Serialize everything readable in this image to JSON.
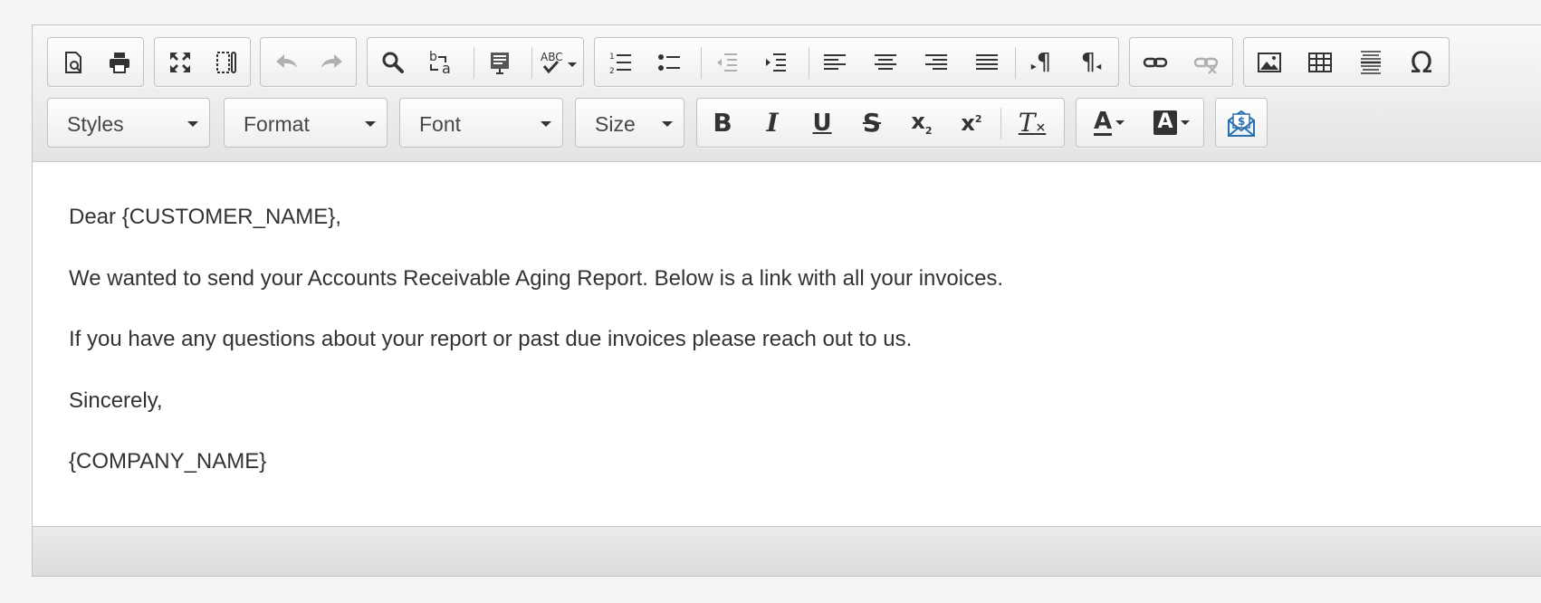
{
  "toolbar": {
    "row1": {
      "document": [
        {
          "name": "preview-icon",
          "title": "Preview"
        },
        {
          "name": "print-icon",
          "title": "Print"
        }
      ],
      "view": [
        {
          "name": "maximize-icon",
          "title": "Maximize"
        },
        {
          "name": "show-blocks-icon",
          "title": "Show Blocks"
        }
      ],
      "history": [
        {
          "name": "undo-icon",
          "title": "Undo",
          "disabled": true
        },
        {
          "name": "redo-icon",
          "title": "Redo",
          "disabled": true
        }
      ],
      "editing": [
        {
          "name": "find-icon",
          "title": "Find"
        },
        {
          "name": "replace-icon",
          "title": "Replace"
        },
        {
          "name": "templates-icon",
          "title": "Templates"
        },
        {
          "name": "spellcheck-icon",
          "title": "Spell Check",
          "label": "ABC"
        }
      ],
      "paragraph": [
        {
          "name": "numbered-list-icon"
        },
        {
          "name": "bulleted-list-icon"
        },
        {
          "name": "outdent-icon",
          "disabled": true
        },
        {
          "name": "indent-icon"
        },
        {
          "name": "align-left-icon"
        },
        {
          "name": "align-center-icon"
        },
        {
          "name": "align-right-icon"
        },
        {
          "name": "justify-icon"
        },
        {
          "name": "ltr-icon",
          "glyph": "¶"
        },
        {
          "name": "rtl-icon",
          "glyph": "¶"
        }
      ],
      "links": [
        {
          "name": "link-icon"
        },
        {
          "name": "unlink-icon",
          "disabled": true
        }
      ],
      "insert": [
        {
          "name": "image-icon"
        },
        {
          "name": "table-icon"
        },
        {
          "name": "horizontal-rule-icon"
        },
        {
          "name": "special-char-icon",
          "glyph": "Ω"
        }
      ]
    },
    "combos": {
      "styles": "Styles",
      "format": "Format",
      "font": "Font",
      "size": "Size"
    },
    "basicstyles": {
      "bold": "B",
      "italic": "I",
      "underline": "U",
      "strike": "S",
      "subscript": "x",
      "superscript": "x",
      "remove_format": "T"
    },
    "colors": {
      "text_color": "A",
      "bg_color": "A"
    },
    "custom": [
      {
        "name": "invoice-email-icon",
        "accent": "#2a6fb0"
      }
    ]
  },
  "content": {
    "lines": [
      "Dear {CUSTOMER_NAME},",
      "We wanted to send your Accounts Receivable Aging Report. Below is a link with all your invoices.",
      "If you have any questions about your report or past due invoices please reach out to us.",
      "Sincerely,",
      "{COMPANY_NAME}"
    ]
  },
  "colors": {
    "icon": "#333333",
    "disabled_icon": "#b0b0b0",
    "accent": "#2a6fb0"
  }
}
